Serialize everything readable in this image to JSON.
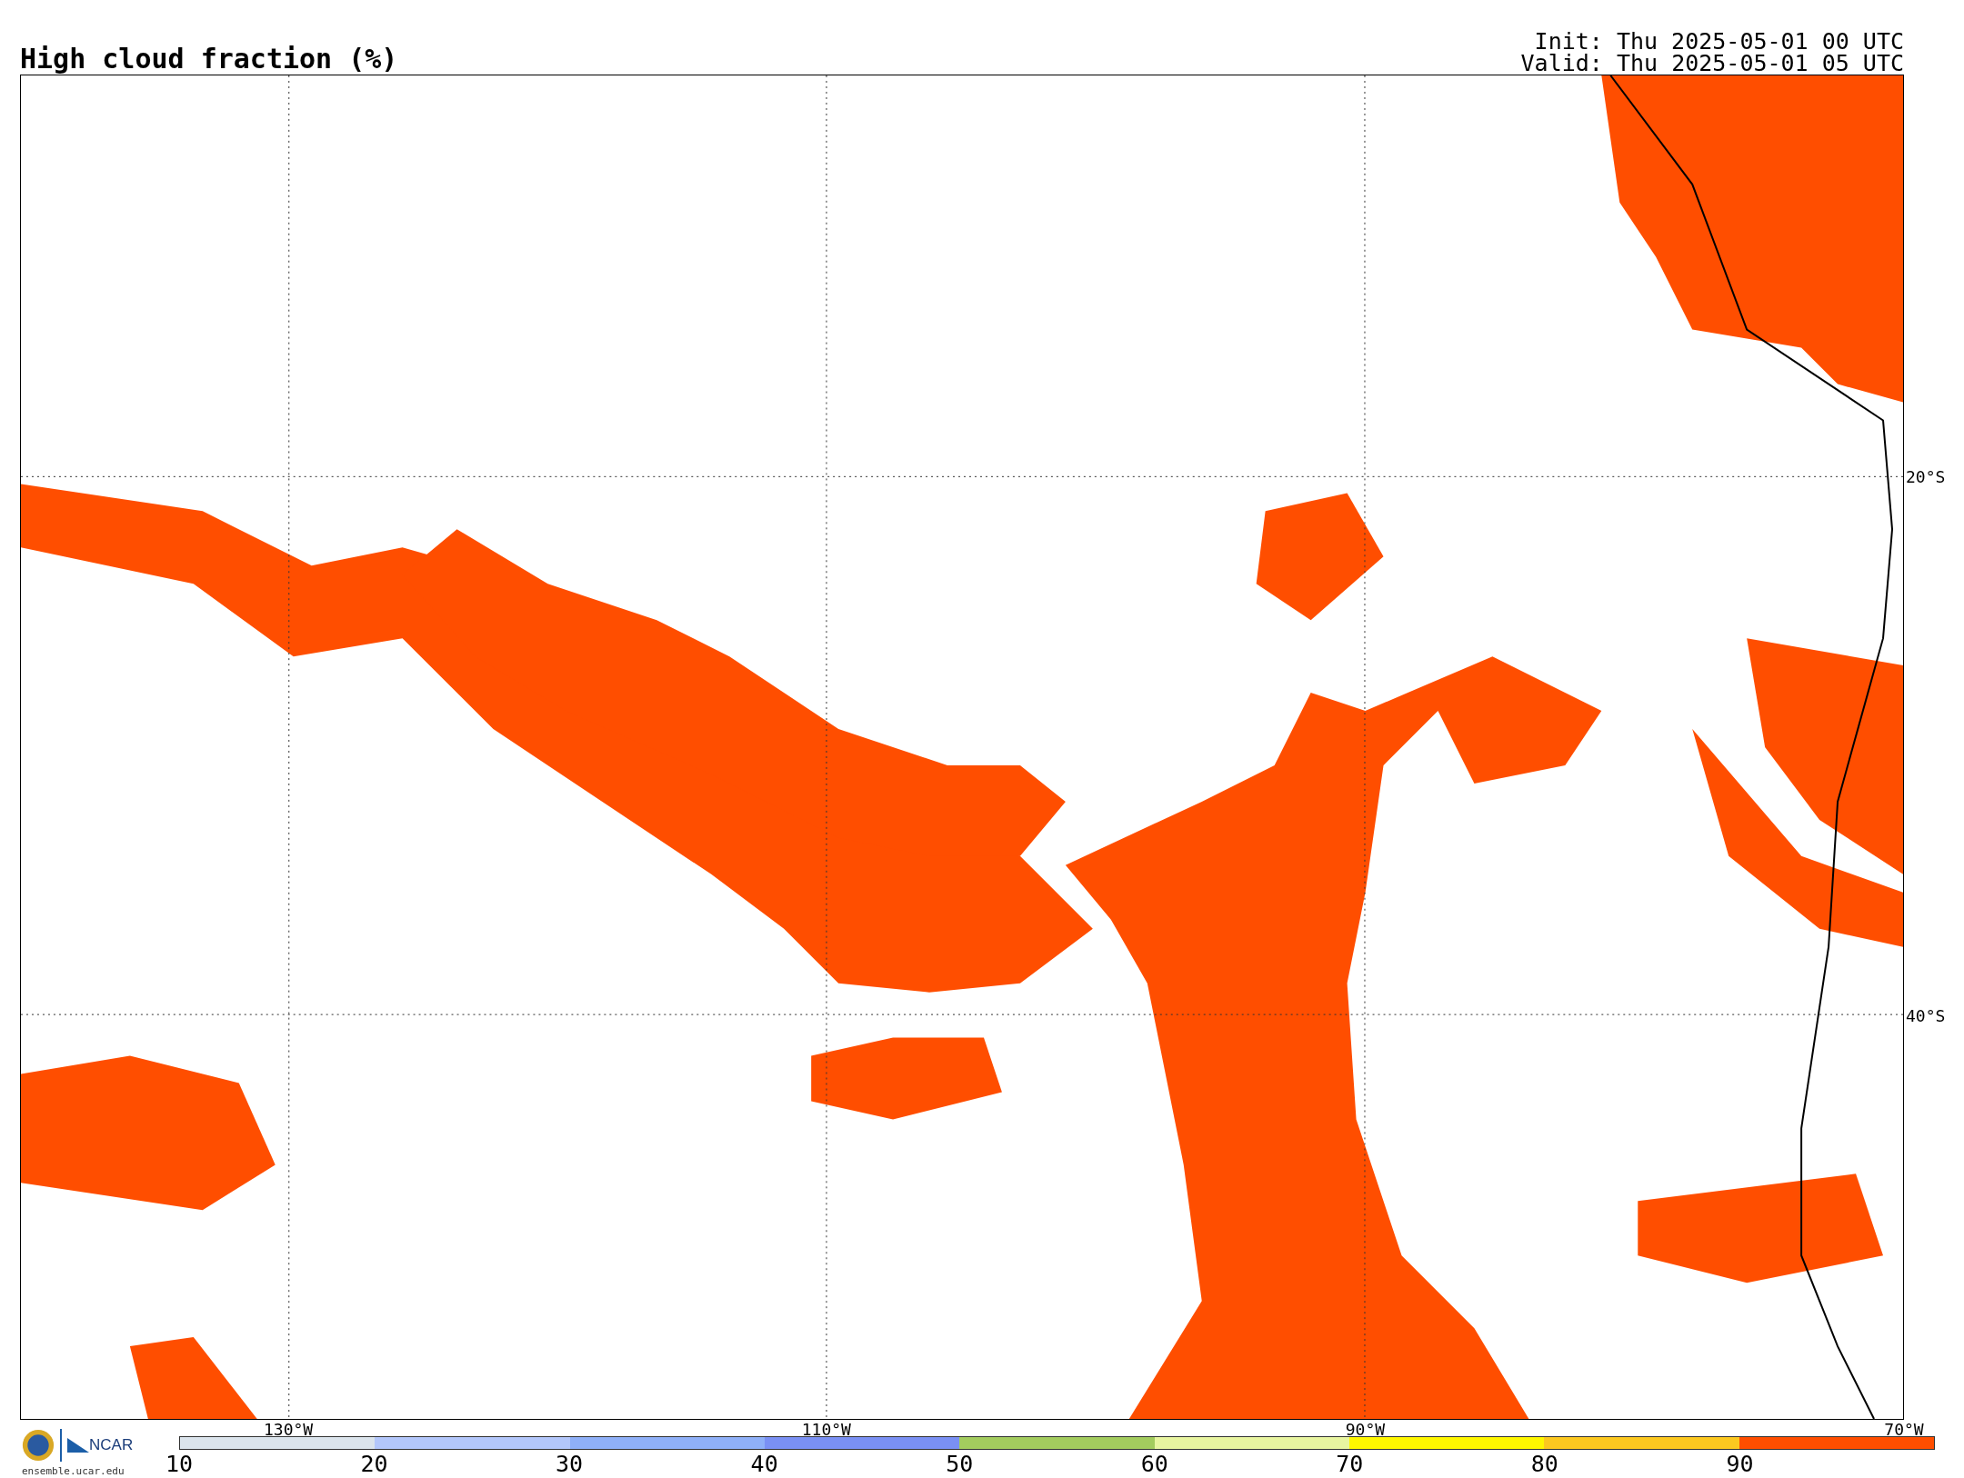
{
  "title": "High cloud fraction (%)",
  "times": [
    "Init: Thu 2025-05-01 00 UTC",
    "Valid: Thu 2025-05-01 05 UTC"
  ],
  "map": {
    "lat_labels": [
      "20°S",
      "40°S"
    ],
    "lon_labels": [
      "130°W",
      "110°W",
      "90°W",
      "70°W"
    ]
  },
  "logo": {
    "brand": "NCAR",
    "site": "ensemble.ucar.edu"
  },
  "colorbar": {
    "bins": [
      {
        "color": "#dbe4ec"
      },
      {
        "color": "#b3c7fb"
      },
      {
        "color": "#8fb0f8"
      },
      {
        "color": "#7a90f4"
      },
      {
        "color": "#a3cc5e"
      },
      {
        "color": "#e8f5a0"
      },
      {
        "color": "#fff700"
      },
      {
        "color": "#fcc820"
      },
      {
        "color": "#ff4e00"
      }
    ],
    "ticks": [
      "10",
      "20",
      "30",
      "40",
      "50",
      "60",
      "70",
      "80",
      "90"
    ]
  }
}
